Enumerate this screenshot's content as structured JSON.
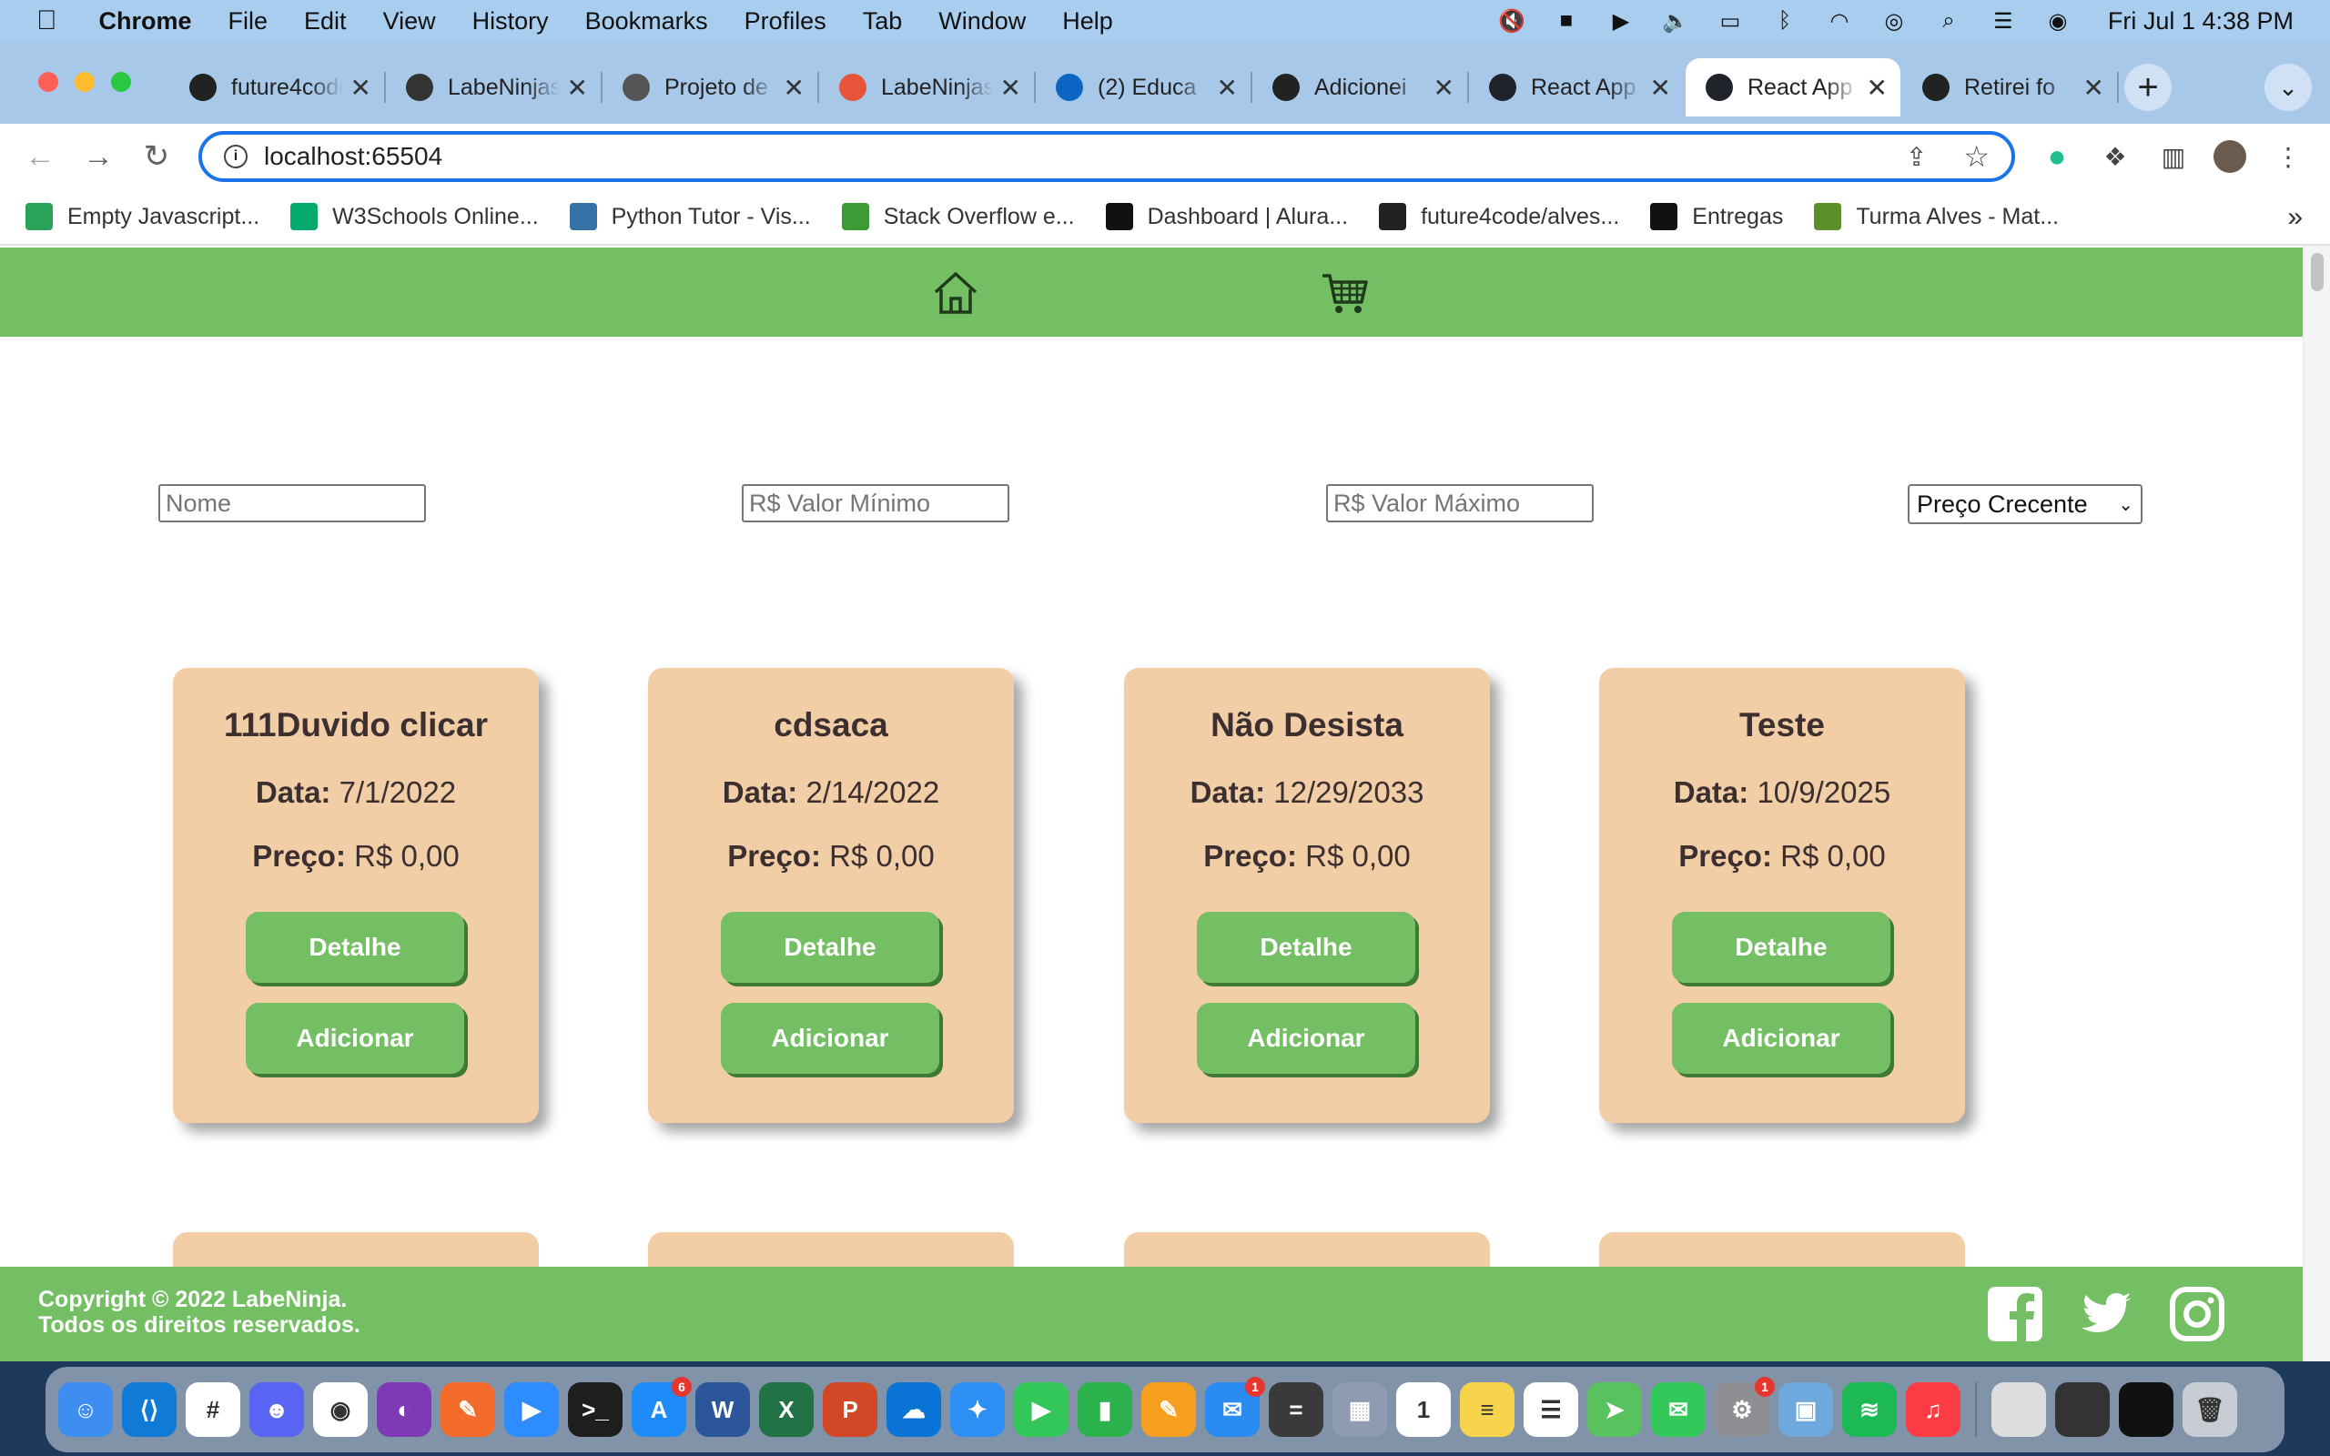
{
  "menubar": {
    "app": "Chrome",
    "items": [
      "File",
      "Edit",
      "View",
      "History",
      "Bookmarks",
      "Profiles",
      "Tab",
      "Window",
      "Help"
    ],
    "clock": "Fri Jul 1  4:38 PM"
  },
  "tabs": [
    {
      "title": "future4code",
      "icon": "github-icon",
      "color": "#222222"
    },
    {
      "title": "LabeNinjas",
      "icon": "trello-icon",
      "color": "#333333"
    },
    {
      "title": "Projeto de",
      "icon": "ninja-icon",
      "color": "#555555"
    },
    {
      "title": "LabeNinjas",
      "icon": "labeninja-icon",
      "color": "#e8543a"
    },
    {
      "title": "(2) Educa",
      "icon": "linkedin-icon",
      "color": "#0a66c2"
    },
    {
      "title": "Adicionei",
      "icon": "github-icon",
      "color": "#222222"
    },
    {
      "title": "React App",
      "icon": "react-icon",
      "color": "#20232a"
    },
    {
      "title": "React App",
      "icon": "react-icon",
      "color": "#20232a"
    },
    {
      "title": "Retirei fo",
      "icon": "github-icon",
      "color": "#222222"
    }
  ],
  "active_tab": 7,
  "omnibox": {
    "url": "localhost:65504"
  },
  "bookmarks": [
    {
      "label": "Empty Javascript...",
      "icon": "codepen-icon",
      "color": "#29a35a"
    },
    {
      "label": "W3Schools Online...",
      "icon": "w3schools-icon",
      "color": "#04aa6d"
    },
    {
      "label": "Python Tutor - Vis...",
      "icon": "python-icon",
      "color": "#3572a5"
    },
    {
      "label": "Stack Overflow e...",
      "icon": "stackoverflow-icon",
      "color": "#3d9b35"
    },
    {
      "label": "Dashboard | Alura...",
      "icon": "alura-icon",
      "color": "#111111"
    },
    {
      "label": "future4code/alves...",
      "icon": "github-icon",
      "color": "#222222"
    },
    {
      "label": "Entregas",
      "icon": "circle-icon",
      "color": "#111111"
    },
    {
      "label": "Turma Alves - Mat...",
      "icon": "parrot-icon",
      "color": "#5a8f29"
    }
  ],
  "filters": {
    "name_placeholder": "Nome",
    "min_placeholder": "R$ Valor Mínimo",
    "max_placeholder": "R$ Valor Máximo",
    "sort_selected": "Preço Crecente"
  },
  "cards": [
    {
      "title": "111Duvido clicar",
      "date_label": "Data:",
      "date": "7/1/2022",
      "price_label": "Preço:",
      "price": "R$ 0,00",
      "detail_btn": "Detalhe",
      "add_btn": "Adicionar"
    },
    {
      "title": "cdsaca",
      "date_label": "Data:",
      "date": "2/14/2022",
      "price_label": "Preço:",
      "price": "R$ 0,00",
      "detail_btn": "Detalhe",
      "add_btn": "Adicionar"
    },
    {
      "title": "Não Desista",
      "date_label": "Data:",
      "date": "12/29/2033",
      "price_label": "Preço:",
      "price": "R$ 0,00",
      "detail_btn": "Detalhe",
      "add_btn": "Adicionar"
    },
    {
      "title": "Teste",
      "date_label": "Data:",
      "date": "10/9/2025",
      "price_label": "Preço:",
      "price": "R$ 0,00",
      "detail_btn": "Detalhe",
      "add_btn": "Adicionar"
    }
  ],
  "footer": {
    "line1": "Copyright © 2022 LabeNinja.",
    "line2": "Todos os direitos reservados."
  },
  "colors": {
    "brand_green": "#74bf64",
    "card_bg": "#f2cea6",
    "focus_blue": "#1a73e8"
  },
  "dock": [
    {
      "name": "finder-icon",
      "color": "#3d8ef0",
      "glyph": "☺"
    },
    {
      "name": "vscode-icon",
      "color": "#0f7bd6",
      "glyph": "⟨⟩"
    },
    {
      "name": "slack-icon",
      "color": "#ffffff",
      "glyph": "#"
    },
    {
      "name": "discord-icon",
      "color": "#5865f2",
      "glyph": "☻"
    },
    {
      "name": "chrome-icon",
      "color": "#ffffff",
      "glyph": "◉"
    },
    {
      "name": "github-desktop-icon",
      "color": "#7e3ab5",
      "glyph": "◐"
    },
    {
      "name": "vectornator-icon",
      "color": "#f26b2b",
      "glyph": "✎"
    },
    {
      "name": "zoom-icon",
      "color": "#2d8cff",
      "glyph": "▶"
    },
    {
      "name": "terminal-icon",
      "color": "#1e1e1e",
      "glyph": ">_"
    },
    {
      "name": "app-store-icon",
      "color": "#1d8cf8",
      "glyph": "A",
      "badge": "6"
    },
    {
      "name": "word-icon",
      "color": "#2b579a",
      "glyph": "W"
    },
    {
      "name": "excel-icon",
      "color": "#217346",
      "glyph": "X"
    },
    {
      "name": "powerpoint-icon",
      "color": "#d24726",
      "glyph": "P"
    },
    {
      "name": "onedrive-icon",
      "color": "#0a74d6",
      "glyph": "☁"
    },
    {
      "name": "safari-icon",
      "color": "#2d8ef3",
      "glyph": "✦"
    },
    {
      "name": "facetime-icon",
      "color": "#33c759",
      "glyph": "▶"
    },
    {
      "name": "numbers-icon",
      "color": "#2cb24c",
      "glyph": "▮"
    },
    {
      "name": "pages-icon",
      "color": "#f7a020",
      "glyph": "✎"
    },
    {
      "name": "mail-icon",
      "color": "#2a8bf2",
      "glyph": "✉",
      "badge": "1"
    },
    {
      "name": "calculator-icon",
      "color": "#3a3a3a",
      "glyph": "="
    },
    {
      "name": "launchpad-icon",
      "color": "#8f9bb0",
      "glyph": "▦"
    },
    {
      "name": "calendar-icon",
      "color": "#ffffff",
      "glyph": "1"
    },
    {
      "name": "notes-icon",
      "color": "#f7d44c",
      "glyph": "≡"
    },
    {
      "name": "reminders-icon",
      "color": "#ffffff",
      "glyph": "☰"
    },
    {
      "name": "maps-icon",
      "color": "#5ac15f",
      "glyph": "➤"
    },
    {
      "name": "messages-icon",
      "color": "#34c759",
      "glyph": "✉"
    },
    {
      "name": "system-preferences-icon",
      "color": "#8e8e93",
      "glyph": "⚙",
      "badge": "1"
    },
    {
      "name": "preview-icon",
      "color": "#6fa8dc",
      "glyph": "▣"
    },
    {
      "name": "spotify-icon",
      "color": "#1db954",
      "glyph": "≋"
    },
    {
      "name": "music-icon",
      "color": "#fc3c44",
      "glyph": "♫"
    },
    {
      "name": "window-thumb-1-icon",
      "color": "#dddddd",
      "glyph": ""
    },
    {
      "name": "window-thumb-2-icon",
      "color": "#333333",
      "glyph": ""
    },
    {
      "name": "window-thumb-3-icon",
      "color": "#111111",
      "glyph": ""
    },
    {
      "name": "trash-icon",
      "color": "#c8cdd3",
      "glyph": "🗑"
    }
  ]
}
